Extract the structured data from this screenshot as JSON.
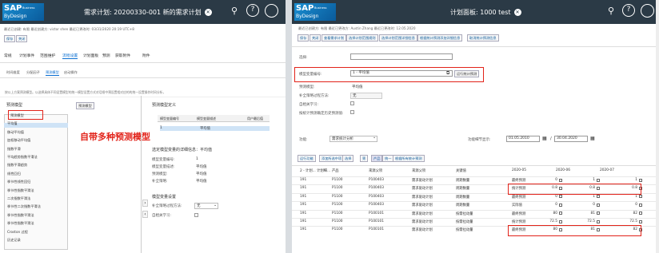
{
  "left": {
    "title": "需求计划: 20200330-001 新的需求计划",
    "meta1": "最近已创建: 有限    最近创建方: victor shen    最近已更改时: 03/31/2020 20:19 UTC+8",
    "buttons": [
      "保存",
      "关闭"
    ],
    "tabs": [
      "常规",
      "计划事件",
      "范围维护",
      "流程设置",
      "计划面板",
      "预测",
      "获取附件",
      "附件"
    ],
    "active_tab": "流程设置",
    "subtabs": [
      "时间维度",
      "分配因子",
      "预测模型",
      "启动操作"
    ],
    "active_subtab": "预测模型",
    "info_text": "按以上方案预测模型。以选择具体不同设置模型的统一模型设置方式对话框中预设置相对应的的统一设置操作时间分析，",
    "list_title": "预测模型",
    "list_btn": "预测模型",
    "list_items": [
      "预测模型",
      "平均值",
      "移动平均值",
      "加权移动平均值",
      "指数平滑",
      "平均趋势指数平滑法",
      "指数平滑趋势",
      "线性回归",
      "季节性线性回归",
      "季节性指数平滑法",
      "二次指数平滑法",
      "季节性二次指数平滑法",
      "季节性指数平滑法",
      "季节性指数平滑法",
      "Croston 过程",
      "历史记录"
    ],
    "annotation": "自带多种预测模型",
    "right_title": "预测模型定义",
    "grid_headers": [
      "模型变量编号",
      "模型变量描述",
      "用户最后值"
    ],
    "grid_row": [
      "1",
      "平均值",
      ""
    ],
    "detail_title": "选定模型变量的详细信息：平均值",
    "detail_labels": [
      "模型变量编号:",
      "模型变量描述:",
      "预测模型:",
      "补全策略:"
    ],
    "detail_values": [
      "1",
      "平均值",
      "平均值",
      "平均值"
    ],
    "settings_title": "模型变量设置",
    "settings_labels": [
      "补全策略过程方法:",
      "自相关学习:"
    ],
    "settings_value": "无"
  },
  "right": {
    "title": "计划面板: 1000 test",
    "meta1": "最近已创建方: 有限    最近已更改方: Austin Zhang    最近已更改时: 12.05.2020",
    "buttons": [
      "保存",
      "关闭",
      "查看需求计划",
      "选择计划范围规则",
      "选择计划范围详细信息",
      "根据统计预测添加详细信息",
      "取消统计预测信息"
    ],
    "selection_label": "选择:",
    "model_label": "模型变量编号:",
    "model_value": "1 - 平均值",
    "model_button": "运行统计预测",
    "rows": [
      [
        "预测模型:",
        "平均值"
      ],
      [
        "补全策略过程方法:",
        "无"
      ],
      [
        "自相关学习:",
        ""
      ],
      [
        "按统计预测确定历史预测值:",
        ""
      ]
    ],
    "func_label": "功能:",
    "func_value": "需求统计分析",
    "interval_label": "功能细节显示:",
    "date_from": "01.05.2010",
    "date_to": "30.04.2020",
    "toolbar": [
      "运行功能",
      "添加所选中项",
      "选择",
      "筛",
      "产品",
      "统一",
      "根据所有统计预测"
    ],
    "col_headers": [
      "2 - 计划... 计划细...",
      "产品",
      "来源父项",
      "来源父项",
      "关键值",
      "2020-05",
      "2020-06",
      "2020-07"
    ],
    "table_rows": [
      [
        "191",
        "P1100",
        "P100403",
        "需求驱动计划",
        "周期数量",
        "最终预测",
        "0",
        "1",
        "1"
      ],
      [
        "191",
        "P1100",
        "P100403",
        "需求驱动计划",
        "周期数量",
        "统计预测",
        "0.8",
        "0.8",
        "0.8"
      ],
      [
        "191",
        "P1100",
        "P100403",
        "需求驱动计划",
        "周期数量",
        "最终预测",
        "0",
        "1",
        "1"
      ],
      [
        "191",
        "P1100",
        "P100403",
        "需求驱动计划",
        "周期数量",
        "实际值",
        "0",
        "0",
        "0"
      ],
      [
        "191",
        "P1100",
        "P100101",
        "需求驱动计划",
        "按需拉动量",
        "最终预测",
        "80",
        "81",
        "82"
      ],
      [
        "191",
        "P1100",
        "P100101",
        "需求驱动计划",
        "按需拉动量",
        "统计预测",
        "72.5",
        "72.5",
        "72.5"
      ],
      [
        "191",
        "P1100",
        "P100101",
        "需求驱动计划",
        "按需拉动量",
        "最终预测",
        "80",
        "81",
        "82"
      ]
    ]
  }
}
